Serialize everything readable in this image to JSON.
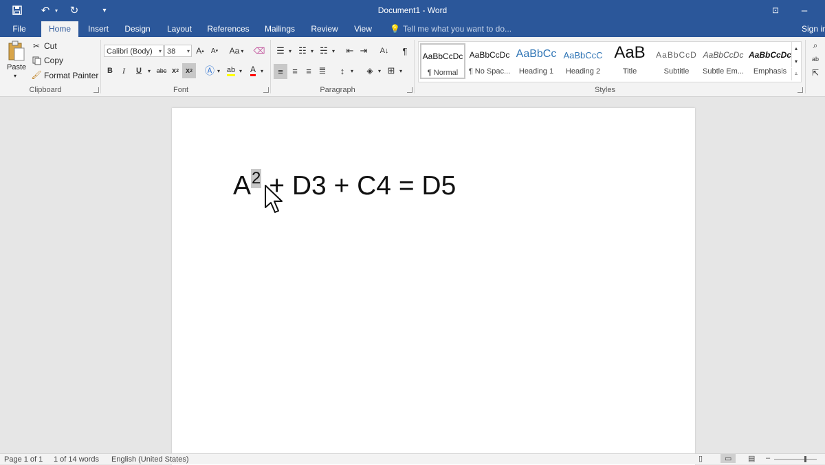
{
  "window": {
    "title": "Document1 - Word"
  },
  "qat": {
    "save_icon": "save-icon",
    "undo_icon": "undo-icon",
    "redo_icon": "redo-icon",
    "customize_icon": "customize-qat-icon"
  },
  "tabs": [
    {
      "label": "File"
    },
    {
      "label": "Home"
    },
    {
      "label": "Insert"
    },
    {
      "label": "Design"
    },
    {
      "label": "Layout"
    },
    {
      "label": "References"
    },
    {
      "label": "Mailings"
    },
    {
      "label": "Review"
    },
    {
      "label": "View"
    }
  ],
  "tellme": {
    "text": "Tell me what you want to do..."
  },
  "signin": {
    "label": "Sign in"
  },
  "clipboard": {
    "paste": "Paste",
    "cut": "Cut",
    "copy": "Copy",
    "format_painter": "Format Painter",
    "group": "Clipboard"
  },
  "font": {
    "name": "Calibri (Body)",
    "size": "38",
    "change_case": "Aa",
    "group": "Font"
  },
  "paragraph": {
    "group": "Paragraph"
  },
  "styles": {
    "group": "Styles",
    "items": [
      {
        "preview": "AaBbCcDc",
        "name": "¶ Normal"
      },
      {
        "preview": "AaBbCcDc",
        "name": "¶ No Spac..."
      },
      {
        "preview": "AaBbCc",
        "name": "Heading 1"
      },
      {
        "preview": "AaBbCcC",
        "name": "Heading 2"
      },
      {
        "preview": "AaB",
        "name": "Title"
      },
      {
        "preview": "AaBbCcD",
        "name": "Subtitle"
      },
      {
        "preview": "AaBbCcDc",
        "name": "Subtle Em..."
      },
      {
        "preview": "AaBbCcDc",
        "name": "Emphasis"
      }
    ]
  },
  "document": {
    "base": "A",
    "superscript": "2",
    "rest": "+ D3 + C4 = D5"
  },
  "status": {
    "page": "Page 1 of 1",
    "words": "1 of 14 words",
    "language": "English (United States)"
  },
  "colors": {
    "accent": "#2b579a",
    "highlight": "#ffff00",
    "font_color": "#ff0000"
  }
}
